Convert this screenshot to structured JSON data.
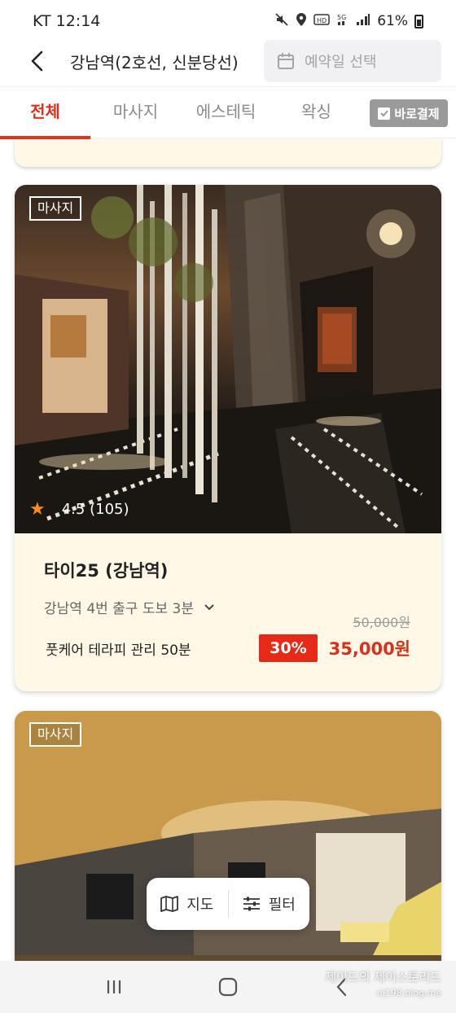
{
  "status_bar": {
    "carrier_time": "KT 12:14",
    "battery": "61%"
  },
  "header": {
    "station": "강남역(2호선, 신분당선)",
    "date_placeholder": "예약일 선택"
  },
  "tabs": [
    {
      "label": "전체",
      "active": true
    },
    {
      "label": "마사지",
      "active": false
    },
    {
      "label": "에스테틱",
      "active": false
    },
    {
      "label": "왁싱",
      "active": false
    }
  ],
  "instant_pay": {
    "label": "바로결제"
  },
  "listings": [
    {
      "category": "마사지",
      "rating": "4.5",
      "review_count": "(105)",
      "name": "타이25 (강남역)",
      "location": "강남역 4번 출구 도보 3분",
      "service": "풋케어 테라피 관리 50분",
      "original_price": "50,000원",
      "discount": "30%",
      "price": "35,000원"
    },
    {
      "category": "마사지"
    }
  ],
  "floating": {
    "map_label": "지도",
    "filter_label": "필터"
  },
  "watermark": {
    "line1": "제이드의 제이스토리드",
    "line2": "nj198.blog.me"
  },
  "colors": {
    "accent": "#e0311c",
    "card_bg": "#fff8e6",
    "discount_bg": "#e72a17"
  }
}
